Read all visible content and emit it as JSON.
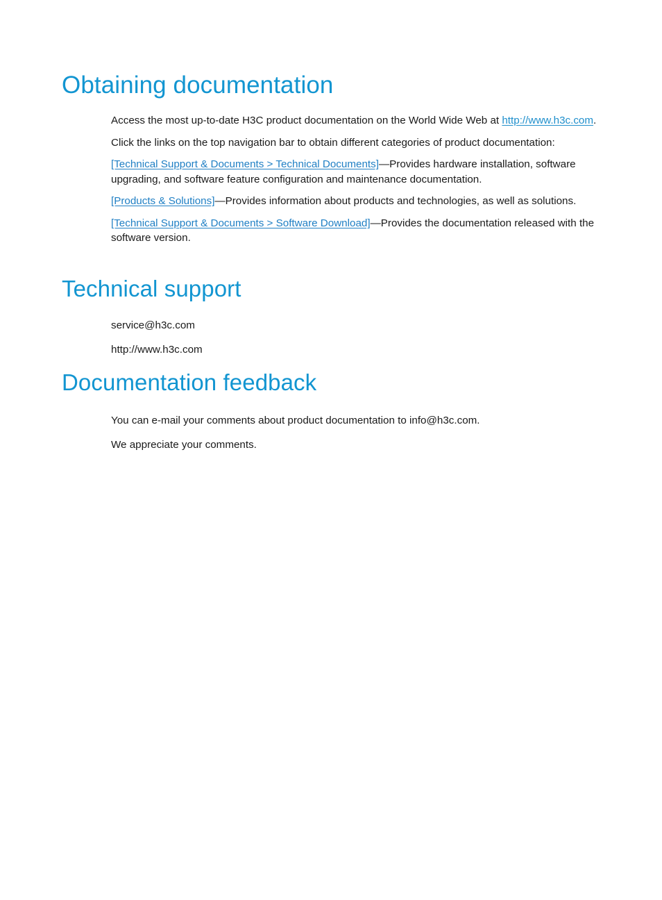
{
  "page": {
    "background_color": "#ffffff",
    "heading_color": "#1295d1",
    "link_color": "#1f7fc4",
    "url_link_color": "#1f8fcc",
    "body_text_color": "#1a1a1a"
  },
  "sections": {
    "obtaining": {
      "heading": "Obtaining documentation",
      "paragraphs": {
        "intro_prefix": "Access the most up-to-date H3C product documentation on the World Wide Web at ",
        "intro_link": "http://www.h3c.com",
        "intro_suffix": ".",
        "click_links": "Click the links on the top navigation bar to obtain different categories of product documentation:",
        "item1_link": "[Technical Support & Documents > Technical Documents]",
        "item1_text": "—Provides hardware installation, software upgrading, and software feature configuration and maintenance documentation.",
        "item2_link": "[Products & Solutions]",
        "item2_text": "—Provides information about products and technologies, as well as solutions.",
        "item3_link": "[Technical Support & Documents > Software Download]",
        "item3_text": "—Provides the documentation released with the software version."
      }
    },
    "technical_support": {
      "heading": "Technical support",
      "email": "service@h3c.com",
      "website": "http://www.h3c.com"
    },
    "documentation_feedback": {
      "heading": "Documentation feedback",
      "line1": "You can e-mail your comments about product documentation to info@h3c.com.",
      "line2": "We appreciate your comments."
    }
  }
}
